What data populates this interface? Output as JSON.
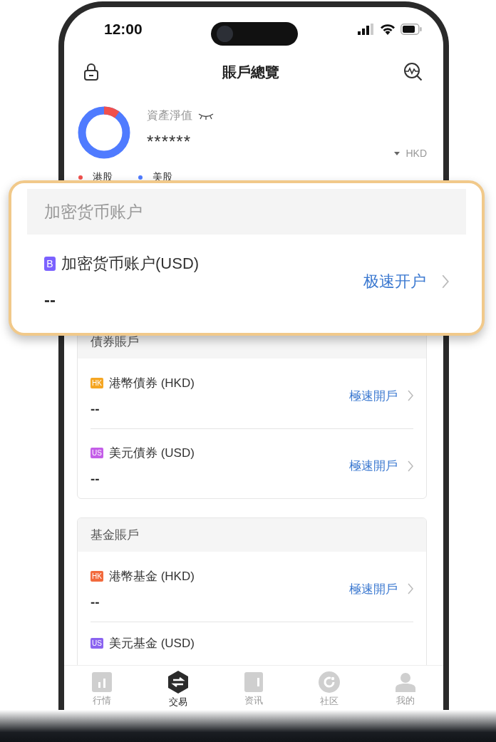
{
  "status_bar": {
    "time": "12:00"
  },
  "header": {
    "title": "賬戶總覽"
  },
  "summary": {
    "label": "資產淨值",
    "value": "******",
    "currency": "HKD",
    "legend": [
      {
        "label": "港股",
        "color": "#f0504d"
      },
      {
        "label": "美股",
        "color": "#4f7bff"
      }
    ]
  },
  "highlight": {
    "title": "加密货币账户",
    "accounts": [
      {
        "badge": "B",
        "color": "#7b61ff",
        "name": "加密货币账户(USD)",
        "value": "--",
        "action": "极速开户"
      }
    ]
  },
  "sections": [
    {
      "title": "債券賬戶",
      "accounts": [
        {
          "badge": "HK",
          "color": "#f5a623",
          "name": "港幣債券 (HKD)",
          "value": "--",
          "action": "極速開戶"
        },
        {
          "badge": "US",
          "color": "#c45ee8",
          "name": "美元債券 (USD)",
          "value": "--",
          "action": "極速開戶"
        }
      ]
    },
    {
      "title": "基金賬戶",
      "accounts": [
        {
          "badge": "HK",
          "color": "#f26a3d",
          "name": "港幣基金 (HKD)",
          "value": "--",
          "action": "極速開戶"
        },
        {
          "badge": "US",
          "color": "#8a63f0",
          "name": "美元基金 (USD)"
        }
      ]
    }
  ],
  "tabs": [
    {
      "label": "行情",
      "kind": "market",
      "selected": false
    },
    {
      "label": "交易",
      "kind": "trade",
      "selected": true
    },
    {
      "label": "资讯",
      "kind": "news",
      "selected": false
    },
    {
      "label": "社区",
      "kind": "community",
      "selected": false
    },
    {
      "label": "我的",
      "kind": "profile",
      "selected": false
    }
  ]
}
